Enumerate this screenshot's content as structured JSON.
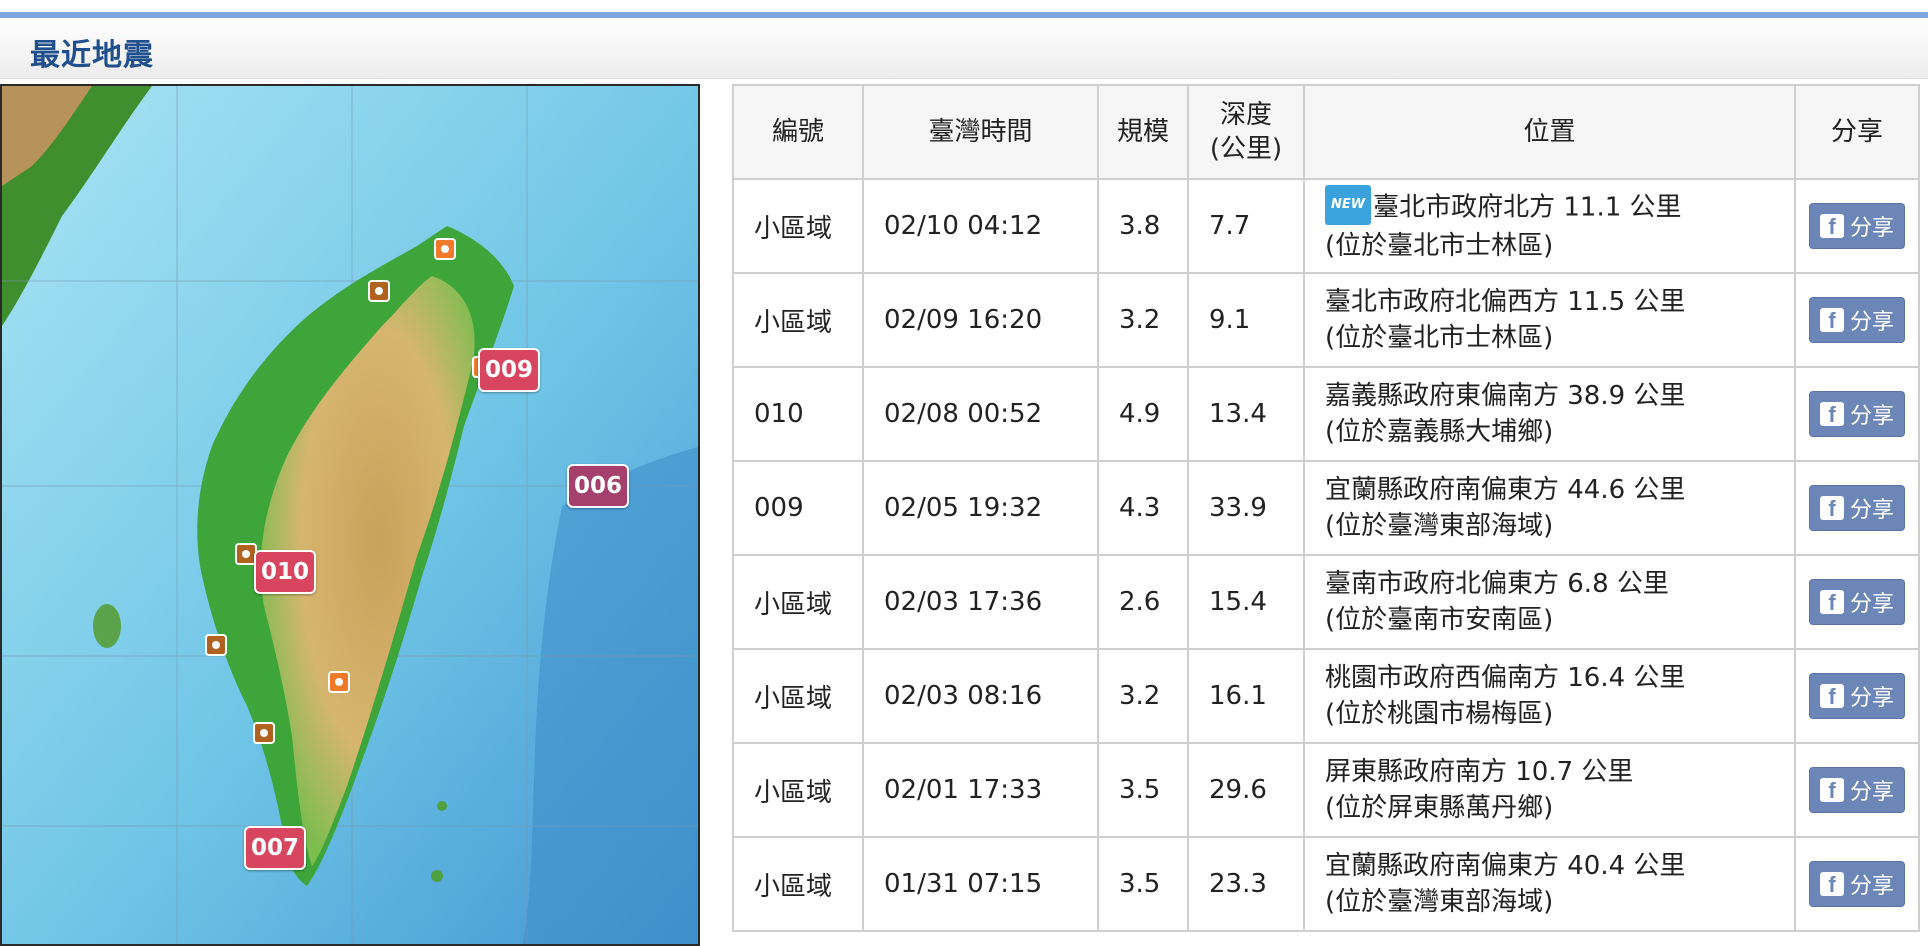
{
  "header": {
    "title": "最近地震"
  },
  "map": {
    "pins": [
      {
        "label": "009",
        "color": "red"
      },
      {
        "label": "006",
        "color": "purple"
      },
      {
        "label": "010",
        "color": "red"
      },
      {
        "label": "007",
        "color": "red"
      }
    ]
  },
  "table": {
    "headers": {
      "id": "編號",
      "time": "臺灣時間",
      "magnitude": "規模",
      "depth_line1": "深度",
      "depth_line2": "(公里)",
      "location": "位置",
      "share": "分享"
    },
    "new_badge": "NEW",
    "share_label": "分享",
    "rows": [
      {
        "id": "小區域",
        "time": "02/10 04:12",
        "mag": "3.8",
        "depth": "7.7",
        "loc1": "臺北市政府北方 11.1 公里",
        "loc2": "(位於臺北市士林區)",
        "is_new": true
      },
      {
        "id": "小區域",
        "time": "02/09 16:20",
        "mag": "3.2",
        "depth": "9.1",
        "loc1": "臺北市政府北偏西方 11.5 公里",
        "loc2": "(位於臺北市士林區)"
      },
      {
        "id": "010",
        "time": "02/08 00:52",
        "mag": "4.9",
        "depth": "13.4",
        "loc1": "嘉義縣政府東偏南方 38.9 公里",
        "loc2": "(位於嘉義縣大埔鄉)"
      },
      {
        "id": "009",
        "time": "02/05 19:32",
        "mag": "4.3",
        "depth": "33.9",
        "loc1": "宜蘭縣政府南偏東方 44.6 公里",
        "loc2": "(位於臺灣東部海域)"
      },
      {
        "id": "小區域",
        "time": "02/03 17:36",
        "mag": "2.6",
        "depth": "15.4",
        "loc1": "臺南市政府北偏東方 6.8 公里",
        "loc2": "(位於臺南市安南區)"
      },
      {
        "id": "小區域",
        "time": "02/03 08:16",
        "mag": "3.2",
        "depth": "16.1",
        "loc1": "桃園市政府西偏南方 16.4 公里",
        "loc2": "(位於桃園市楊梅區)"
      },
      {
        "id": "小區域",
        "time": "02/01 17:33",
        "mag": "3.5",
        "depth": "29.6",
        "loc1": "屏東縣政府南方 10.7 公里",
        "loc2": "(位於屏東縣萬丹鄉)"
      },
      {
        "id": "小區域",
        "time": "01/31 07:15",
        "mag": "3.5",
        "depth": "23.3",
        "loc1": "宜蘭縣政府南偏東方 40.4 公里",
        "loc2": "(位於臺灣東部海域)"
      }
    ]
  }
}
